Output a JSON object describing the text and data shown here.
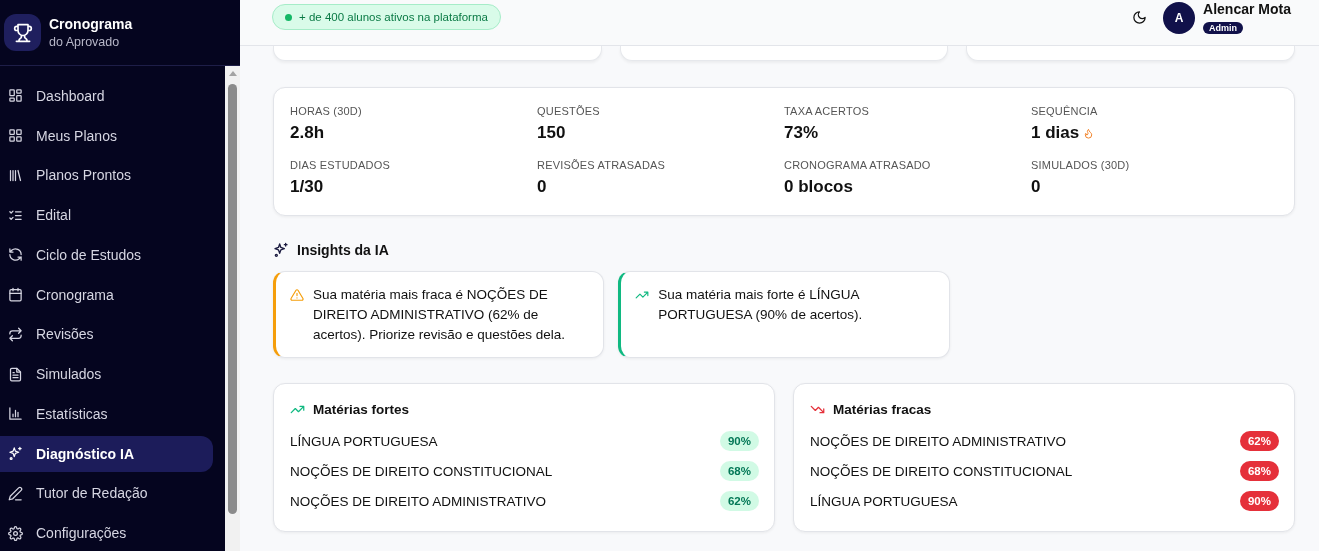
{
  "sidebar": {
    "brand": {
      "title": "Cronograma",
      "subtitle": "do Aprovado"
    },
    "items": [
      {
        "label": "Dashboard",
        "selected": false
      },
      {
        "label": "Meus Planos",
        "selected": false
      },
      {
        "label": "Planos Prontos",
        "selected": false
      },
      {
        "label": "Edital",
        "selected": false
      },
      {
        "label": "Ciclo de Estudos",
        "selected": false
      },
      {
        "label": "Cronograma",
        "selected": false
      },
      {
        "label": "Revisões",
        "selected": false
      },
      {
        "label": "Simulados",
        "selected": false
      },
      {
        "label": "Estatísticas",
        "selected": false
      },
      {
        "label": "Diagnóstico IA",
        "selected": true
      },
      {
        "label": "Tutor de Redação",
        "selected": false
      },
      {
        "label": "Configurações",
        "selected": false
      }
    ]
  },
  "header": {
    "badge": "+ de 400 alunos ativos na plataforma",
    "user": {
      "initial": "A",
      "name": "Alencar Mota",
      "role": "Admin"
    }
  },
  "stats": [
    {
      "label": "HORAS (30D)",
      "value": "2.8h",
      "kind": "plain"
    },
    {
      "label": "QUESTÕES",
      "value": "150",
      "kind": "plain"
    },
    {
      "label": "TAXA ACERTOS",
      "value": "73%",
      "kind": "plain"
    },
    {
      "label": "SEQUÊNCIA",
      "value": "1 dias",
      "kind": "streak"
    },
    {
      "label": "DIAS ESTUDADOS",
      "value": "1/30",
      "kind": "plain"
    },
    {
      "label": "REVISÕES ATRASADAS",
      "value": "0",
      "kind": "plain"
    },
    {
      "label": "CRONOGRAMA ATRASADO",
      "value": "0 blocos",
      "kind": "plain"
    },
    {
      "label": "SIMULADOS (30D)",
      "value": "0",
      "kind": "plain"
    }
  ],
  "insights": {
    "title": "Insights da IA",
    "items": [
      {
        "kind": "warning",
        "text": "Sua matéria mais fraca é NOÇÕES DE DIREITO ADMINISTRATIVO (62% de acertos). Priorize revisão e questões dela."
      },
      {
        "kind": "positive",
        "text": "Sua matéria mais forte é LÍNGUA PORTUGUESA (90% de acertos)."
      }
    ]
  },
  "subject_cards": [
    {
      "kind": "strong",
      "title": "Matérias fortes",
      "rows": [
        {
          "name": "LÍNGUA PORTUGUESA",
          "percent": "90%"
        },
        {
          "name": "NOÇÕES DE DIREITO CONSTITUCIONAL",
          "percent": "68%"
        },
        {
          "name": "NOÇÕES DE DIREITO ADMINISTRATIVO",
          "percent": "62%"
        }
      ]
    },
    {
      "kind": "weak",
      "title": "Matérias fracas",
      "rows": [
        {
          "name": "NOÇÕES DE DIREITO ADMINISTRATIVO",
          "percent": "62%"
        },
        {
          "name": "NOÇÕES DE DIREITO CONSTITUCIONAL",
          "percent": "68%"
        },
        {
          "name": "LÍNGUA PORTUGUESA",
          "percent": "90%"
        }
      ]
    }
  ]
}
